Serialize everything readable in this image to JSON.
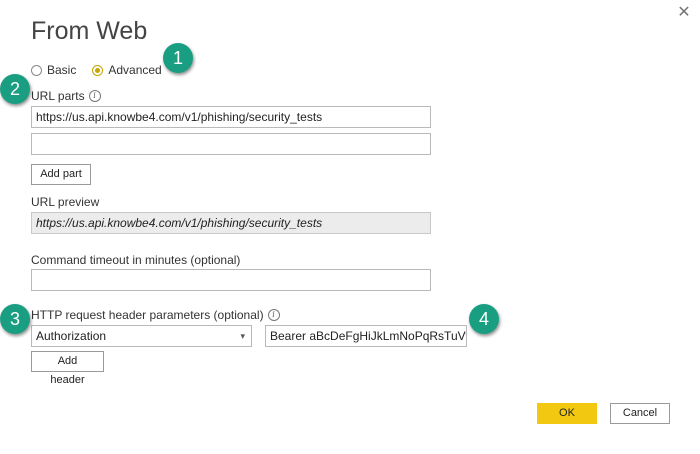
{
  "dialog": {
    "title": "From Web",
    "close_icon": "close-icon"
  },
  "mode": {
    "options": [
      {
        "label": "Basic",
        "selected": false
      },
      {
        "label": "Advanced",
        "selected": true
      }
    ]
  },
  "url_parts": {
    "label": "URL parts",
    "parts": [
      "https://us.api.knowbe4.com/v1/phishing/security_tests",
      ""
    ],
    "add_part_label": "Add part"
  },
  "url_preview": {
    "label": "URL preview",
    "value": "https://us.api.knowbe4.com/v1/phishing/security_tests"
  },
  "timeout": {
    "label": "Command timeout in minutes (optional)",
    "value": ""
  },
  "headers": {
    "label": "HTTP request header parameters (optional)",
    "name_value": "Authorization",
    "header_value": "Bearer aBcDeFgHiJkLmNoPqRsTuVwX",
    "add_header_label": "Add header"
  },
  "footer": {
    "ok_label": "OK",
    "cancel_label": "Cancel"
  },
  "callouts": [
    "1",
    "2",
    "3",
    "4"
  ],
  "colors": {
    "accent": "#f2c811",
    "callout": "#1a9e82"
  }
}
